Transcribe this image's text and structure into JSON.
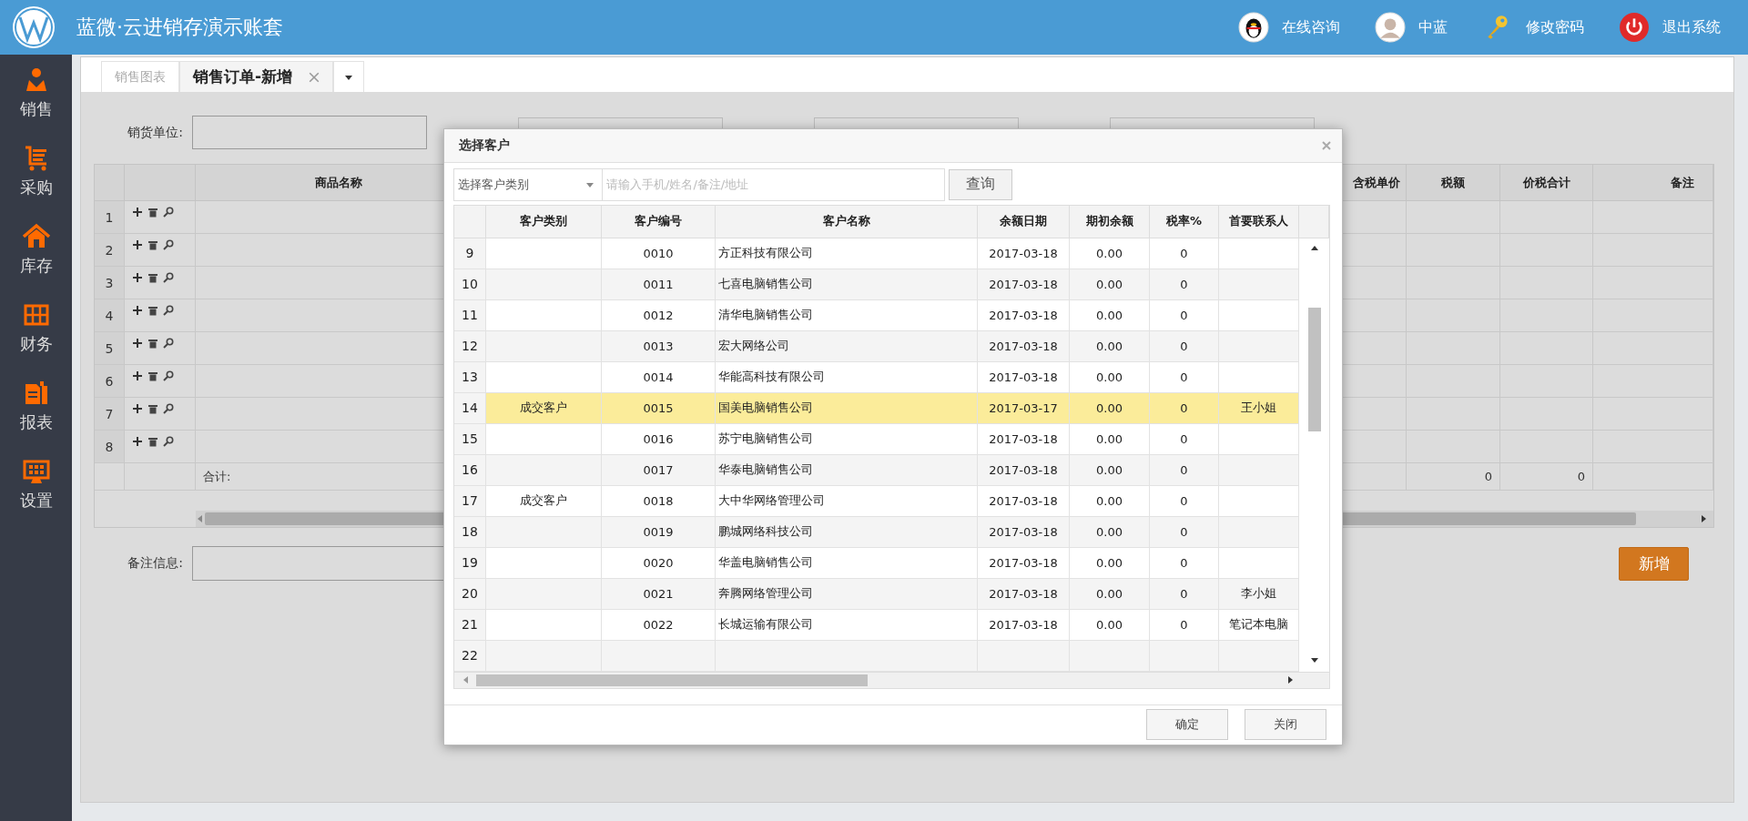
{
  "header": {
    "title": "蓝微·云进销存演示账套",
    "links": [
      {
        "kind": "qq",
        "label": "在线咨询"
      },
      {
        "kind": "avatar",
        "label": "中蓝"
      },
      {
        "kind": "key",
        "label": "修改密码"
      },
      {
        "kind": "power",
        "label": "退出系统"
      }
    ]
  },
  "sidebar": {
    "items": [
      {
        "kind": "sales",
        "label": "销售"
      },
      {
        "kind": "purchase",
        "label": "采购"
      },
      {
        "kind": "stock",
        "label": "库存"
      },
      {
        "kind": "finance",
        "label": "财务"
      },
      {
        "kind": "report",
        "label": "报表"
      },
      {
        "kind": "settings",
        "label": "设置"
      }
    ]
  },
  "tabs": [
    {
      "label": "销售图表",
      "selected": false,
      "closable": false
    },
    {
      "label": "销售订单-新增",
      "selected": true,
      "closable": true
    }
  ],
  "form": {
    "seller_label": "销货单位:",
    "remark_label": "备注信息:",
    "add_button": "新增"
  },
  "order_grid": {
    "columns": {
      "product": "商品名称",
      "price_incl_tax": "含税单价",
      "tax": "税额",
      "total": "价税合计",
      "note": "备注"
    },
    "rows": [
      "1",
      "2",
      "3",
      "4",
      "5",
      "6",
      "7",
      "8"
    ],
    "totals": {
      "label": "合计:",
      "tax": "0",
      "total": "0"
    }
  },
  "dialog": {
    "title": "选择客户",
    "category_select": "选择客户类别",
    "search": {
      "placeholder": "请输入手机/姓名/备注/地址"
    },
    "query_button": "查询",
    "columns": [
      "客户类别",
      "客户编号",
      "客户名称",
      "余额日期",
      "期初余额",
      "税率%",
      "首要联系人"
    ],
    "rows": [
      {
        "no": "9",
        "code": "0010",
        "name": "方正科技有限公司",
        "date": "2017-03-18",
        "opening": "0.00",
        "tax_rate": "0",
        "selected": false
      },
      {
        "no": "10",
        "code": "0011",
        "name": "七喜电脑销售公司",
        "date": "2017-03-18",
        "opening": "0.00",
        "tax_rate": "0",
        "selected": false
      },
      {
        "no": "11",
        "code": "0012",
        "name": "清华电脑销售公司",
        "date": "2017-03-18",
        "opening": "0.00",
        "tax_rate": "0",
        "selected": false
      },
      {
        "no": "12",
        "code": "0013",
        "name": "宏大网络公司",
        "date": "2017-03-18",
        "opening": "0.00",
        "tax_rate": "0",
        "selected": false
      },
      {
        "no": "13",
        "code": "0014",
        "name": "华能高科技有限公司",
        "date": "2017-03-18",
        "opening": "0.00",
        "tax_rate": "0",
        "selected": false
      },
      {
        "no": "14",
        "category": "成交客户",
        "code": "0015",
        "name": "国美电脑销售公司",
        "date": "2017-03-17",
        "opening": "0.00",
        "tax_rate": "0",
        "contact": "王小姐",
        "selected": true
      },
      {
        "no": "15",
        "code": "0016",
        "name": "苏宁电脑销售公司",
        "date": "2017-03-18",
        "opening": "0.00",
        "tax_rate": "0",
        "selected": false
      },
      {
        "no": "16",
        "code": "0017",
        "name": "华泰电脑销售公司",
        "date": "2017-03-18",
        "opening": "0.00",
        "tax_rate": "0",
        "selected": false
      },
      {
        "no": "17",
        "category": "成交客户",
        "code": "0018",
        "name": "大中华网络管理公司",
        "date": "2017-03-18",
        "opening": "0.00",
        "tax_rate": "0",
        "selected": false
      },
      {
        "no": "18",
        "code": "0019",
        "name": "鹏城网络科技公司",
        "date": "2017-03-18",
        "opening": "0.00",
        "tax_rate": "0",
        "selected": false
      },
      {
        "no": "19",
        "code": "0020",
        "name": "华盖电脑销售公司",
        "date": "2017-03-18",
        "opening": "0.00",
        "tax_rate": "0",
        "selected": false
      },
      {
        "no": "20",
        "code": "0021",
        "name": "奔腾网络管理公司",
        "date": "2017-03-18",
        "opening": "0.00",
        "tax_rate": "0",
        "contact": "李小姐",
        "selected": false
      },
      {
        "no": "21",
        "code": "0022",
        "name": "长城运输有限公司",
        "date": "2017-03-18",
        "opening": "0.00",
        "tax_rate": "0",
        "contact": "笔记本电脑",
        "selected": false
      },
      {
        "no": "22",
        "selected": false
      }
    ],
    "buttons": [
      "确定",
      "关闭"
    ]
  }
}
